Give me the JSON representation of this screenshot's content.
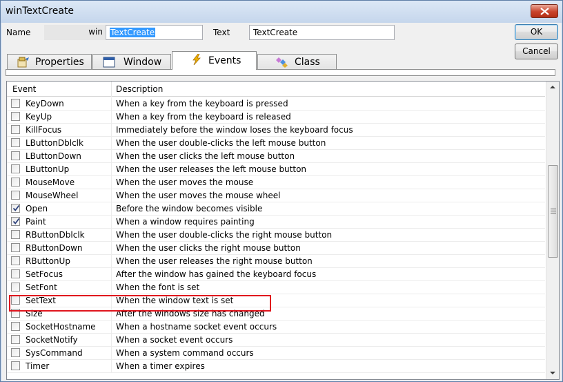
{
  "window": {
    "title": "winTextCreate"
  },
  "form": {
    "name_label": "Name",
    "name_prefix": "win",
    "name_value": "TextCreate",
    "text_label": "Text",
    "text_value": "TextCreate",
    "ok_label": "OK",
    "cancel_label": "Cancel"
  },
  "tabs": [
    {
      "label": "Properties",
      "icon": "properties-icon",
      "active": false
    },
    {
      "label": "Window",
      "icon": "window-icon",
      "active": false
    },
    {
      "label": "Events",
      "icon": "lightning-icon",
      "active": true
    },
    {
      "label": "Class",
      "icon": "class-icon",
      "active": false
    }
  ],
  "grid": {
    "columns": [
      "Event",
      "Description"
    ],
    "rows": [
      {
        "event": "KeyDown",
        "description": "When a key from the keyboard is pressed",
        "checked": false
      },
      {
        "event": "KeyUp",
        "description": "When a key from the keyboard is released",
        "checked": false
      },
      {
        "event": "KillFocus",
        "description": "Immediately before the window loses the keyboard focus",
        "checked": false
      },
      {
        "event": "LButtonDblclk",
        "description": "When the user double-clicks the left mouse button",
        "checked": false
      },
      {
        "event": "LButtonDown",
        "description": "When the user clicks the left mouse button",
        "checked": false
      },
      {
        "event": "LButtonUp",
        "description": "When the user releases the left mouse button",
        "checked": false
      },
      {
        "event": "MouseMove",
        "description": "When the user moves the mouse",
        "checked": false
      },
      {
        "event": "MouseWheel",
        "description": "When the user moves the mouse wheel",
        "checked": false
      },
      {
        "event": "Open",
        "description": "Before the window becomes visible",
        "checked": true
      },
      {
        "event": "Paint",
        "description": "When a window requires painting",
        "checked": true,
        "highlighted": true
      },
      {
        "event": "RButtonDblclk",
        "description": "When the user double-clicks the right mouse button",
        "checked": false
      },
      {
        "event": "RButtonDown",
        "description": "When the user clicks the right mouse button",
        "checked": false
      },
      {
        "event": "RButtonUp",
        "description": "When the user releases the right mouse button",
        "checked": false
      },
      {
        "event": "SetFocus",
        "description": "After the window has gained the keyboard focus",
        "checked": false
      },
      {
        "event": "SetFont",
        "description": "When the font is set",
        "checked": false
      },
      {
        "event": "SetText",
        "description": "When the window text is set",
        "checked": false
      },
      {
        "event": "Size",
        "description": "After the windows size has changed",
        "checked": false
      },
      {
        "event": "SocketHostname",
        "description": "When a hostname socket event occurs",
        "checked": false
      },
      {
        "event": "SocketNotify",
        "description": "When a socket event occurs",
        "checked": false
      },
      {
        "event": "SysCommand",
        "description": "When a system command occurs",
        "checked": false
      },
      {
        "event": "Timer",
        "description": "When a timer expires",
        "checked": false
      }
    ]
  },
  "colors": {
    "highlight_border": "#e0141d",
    "selection": "#3399ff",
    "close_button": "#c9442c"
  }
}
